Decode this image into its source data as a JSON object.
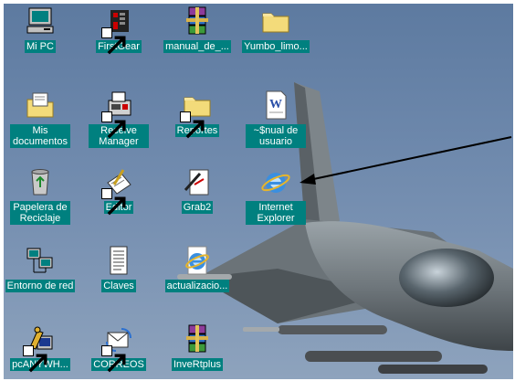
{
  "desktop": {
    "icons": [
      {
        "label": "Mi PC",
        "icon": "my-computer-icon"
      },
      {
        "label": "FirstGear",
        "icon": "firstgear-icon"
      },
      {
        "label": "manual_de_...",
        "icon": "winrar-archive-icon"
      },
      {
        "label": "Yumbo_limo...",
        "icon": "folder-icon"
      },
      {
        "label": "Mis documentos",
        "icon": "my-documents-icon"
      },
      {
        "label": "Receive Manager",
        "icon": "fax-receive-icon"
      },
      {
        "label": "Reportes",
        "icon": "folder-icon"
      },
      {
        "label": "~$nual de usuario",
        "icon": "word-document-icon"
      },
      {
        "label": "Papelera de Reciclaje",
        "icon": "recycle-bin-icon"
      },
      {
        "label": "Editor",
        "icon": "notepad-editor-icon"
      },
      {
        "label": "Grab2",
        "icon": "grab-tool-icon"
      },
      {
        "label": "Internet Explorer",
        "icon": "internet-explorer-icon"
      },
      {
        "label": "Entorno de red",
        "icon": "network-neighborhood-icon"
      },
      {
        "label": "Claves",
        "icon": "text-document-icon"
      },
      {
        "label": "actualizacio...",
        "icon": "internet-explorer-icon"
      },
      {
        "label": "pcANYWH...",
        "icon": "pcanywhere-icon"
      },
      {
        "label": "CORREOS",
        "icon": "mail-icon"
      },
      {
        "label": "InveRtplus",
        "icon": "winrar-archive-icon"
      }
    ]
  },
  "colors": {
    "label_bg": "#00807f",
    "label_text": "#ffffff"
  }
}
